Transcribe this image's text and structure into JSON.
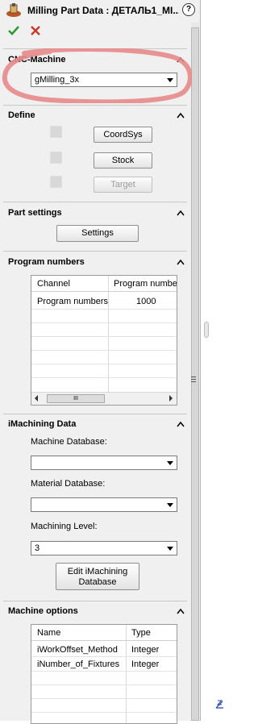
{
  "title": "Milling Part Data : ДЕТАЛЬ1_МІ...",
  "help_label": "?",
  "sections": {
    "cnc": {
      "header": "CNC-Machine",
      "machine_value": "gMilling_3x"
    },
    "define": {
      "header": "Define",
      "coordsys_label": "CoordSys",
      "stock_label": "Stock",
      "target_label": "Target"
    },
    "part_settings": {
      "header": "Part settings",
      "settings_label": "Settings"
    },
    "program_numbers": {
      "header": "Program numbers",
      "columns": [
        "Channel",
        "Program number"
      ],
      "rows": [
        [
          "Program numbers",
          "1000"
        ]
      ],
      "scroll_thumb": "III"
    },
    "imachining": {
      "header": "iMachining Data",
      "machine_db_label": "Machine Database:",
      "machine_db_value": "",
      "material_db_label": "Material Database:",
      "material_db_value": "",
      "level_label": "Machining Level:",
      "level_value": "3",
      "edit_line1": "Edit iMachining",
      "edit_line2": "Database"
    },
    "machine_options": {
      "header": "Machine options",
      "columns": [
        "Name",
        "Type"
      ],
      "rows": [
        [
          "iWorkOffset_Method",
          "Integer"
        ],
        [
          "iNumber_of_Fixtures",
          "Integer"
        ]
      ]
    }
  },
  "colors": {
    "panel_bg": "#f0f0f0",
    "highlight_circle": "#e88a8a",
    "ok_check": "#2a9a2a",
    "cancel_x": "#c83a2a"
  }
}
